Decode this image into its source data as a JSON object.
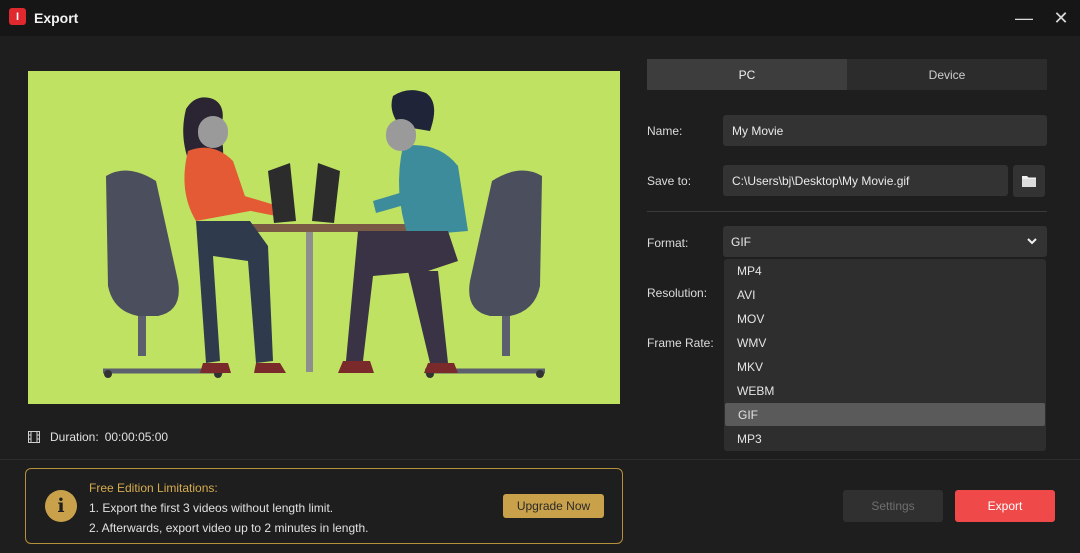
{
  "window": {
    "title": "Export",
    "logo_glyph": "I",
    "minimize_glyph": "—",
    "close_glyph": "✕"
  },
  "preview": {
    "duration_label": "Duration:",
    "duration_value": "00:00:05:00"
  },
  "tabs": [
    {
      "label": "PC",
      "active": true
    },
    {
      "label": "Device",
      "active": false
    }
  ],
  "form": {
    "name_label": "Name:",
    "name_value": "My Movie",
    "save_label": "Save to:",
    "save_value": "C:\\Users\\bj\\Desktop\\My Movie.gif",
    "format_label": "Format:",
    "format_value": "GIF",
    "resolution_label": "Resolution:",
    "frame_rate_label": "Frame Rate:"
  },
  "format_options": [
    "MP4",
    "AVI",
    "MOV",
    "WMV",
    "MKV",
    "WEBM",
    "GIF",
    "MP3"
  ],
  "selected_format": "GIF",
  "notice": {
    "title": "Free Edition Limitations:",
    "line1": "1. Export the first 3 videos without length limit.",
    "line2": "2. Afterwards, export video up to 2 minutes in length.",
    "upgrade_label": "Upgrade Now"
  },
  "buttons": {
    "settings_label": "Settings",
    "export_label": "Export"
  },
  "colors": {
    "accent_red": "#ef4a49",
    "gold": "#c9a14a",
    "preview_bg": "#bfe263"
  },
  "icons": {
    "folder": "folder-icon",
    "chevron": "chevron-down-icon",
    "film": "film-icon",
    "info": "info-icon"
  }
}
